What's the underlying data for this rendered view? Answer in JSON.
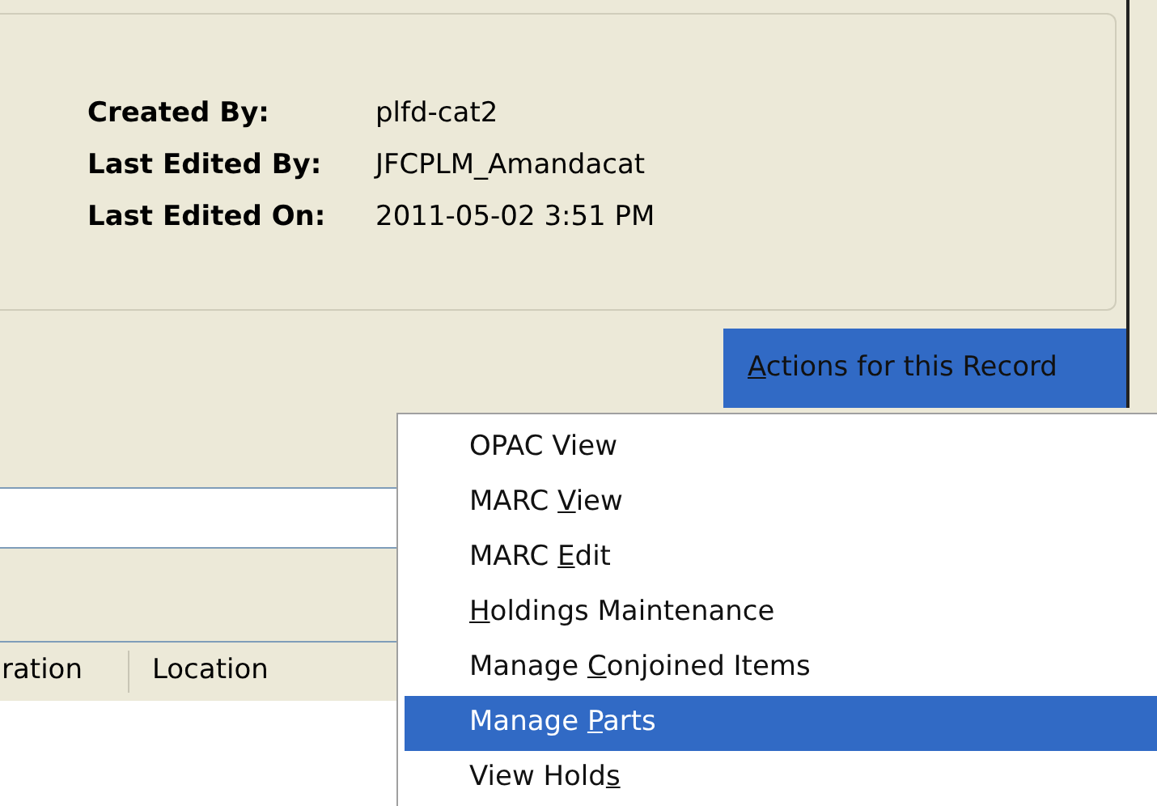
{
  "record_info": [
    {
      "label": "Created By:",
      "value": "plfd-cat2"
    },
    {
      "label": "Last Edited By:",
      "value": "JFCPLM_Amandacat"
    },
    {
      "label": "Last Edited On:",
      "value": "2011-05-02 3:51 PM"
    }
  ],
  "actions_button": {
    "key": "A",
    "post": "ctions for this Record"
  },
  "columns": [
    "ration",
    "Location"
  ],
  "menu": [
    {
      "pre": "OPAC View",
      "selected": false
    },
    {
      "pre": "MARC ",
      "key": "V",
      "post": "iew",
      "selected": false
    },
    {
      "pre": "MARC ",
      "key": "E",
      "post": "dit",
      "selected": false
    },
    {
      "key": "H",
      "post": "oldings Maintenance",
      "selected": false
    },
    {
      "pre": "Manage ",
      "key": "C",
      "post": "onjoined Items",
      "selected": false
    },
    {
      "pre": "Manage ",
      "key": "P",
      "post": "arts",
      "selected": true
    },
    {
      "pre": "View Hold",
      "key": "s",
      "selected": false
    }
  ]
}
